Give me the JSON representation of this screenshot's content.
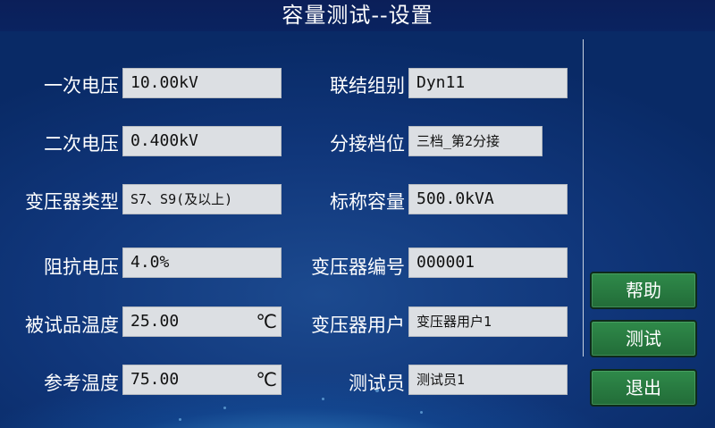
{
  "header": {
    "title": "容量测试--设置"
  },
  "left": [
    {
      "label": "一次电压",
      "value": "10.00kV",
      "unit": ""
    },
    {
      "label": "二次电压",
      "value": "0.400kV",
      "unit": ""
    },
    {
      "label": "变压器类型",
      "value": "S7、S9(及以上)",
      "unit": ""
    },
    {
      "label": "阻抗电压",
      "value": "4.0%",
      "unit": ""
    },
    {
      "label": "被试品温度",
      "value": "25.00",
      "unit": "℃"
    },
    {
      "label": "参考温度",
      "value": "75.00",
      "unit": "℃"
    }
  ],
  "right": [
    {
      "label": "联结组别",
      "value": "Dyn11"
    },
    {
      "label": "分接档位",
      "value": "三档_第2分接"
    },
    {
      "label": "标称容量",
      "value": "500.0kVA"
    },
    {
      "label": "变压器编号",
      "value": "000001"
    },
    {
      "label": "变压器用户",
      "value": "变压器用户1"
    },
    {
      "label": "测试员",
      "value": "测试员1"
    }
  ],
  "buttons": {
    "help": "帮助",
    "test": "测试",
    "exit": "退出"
  }
}
